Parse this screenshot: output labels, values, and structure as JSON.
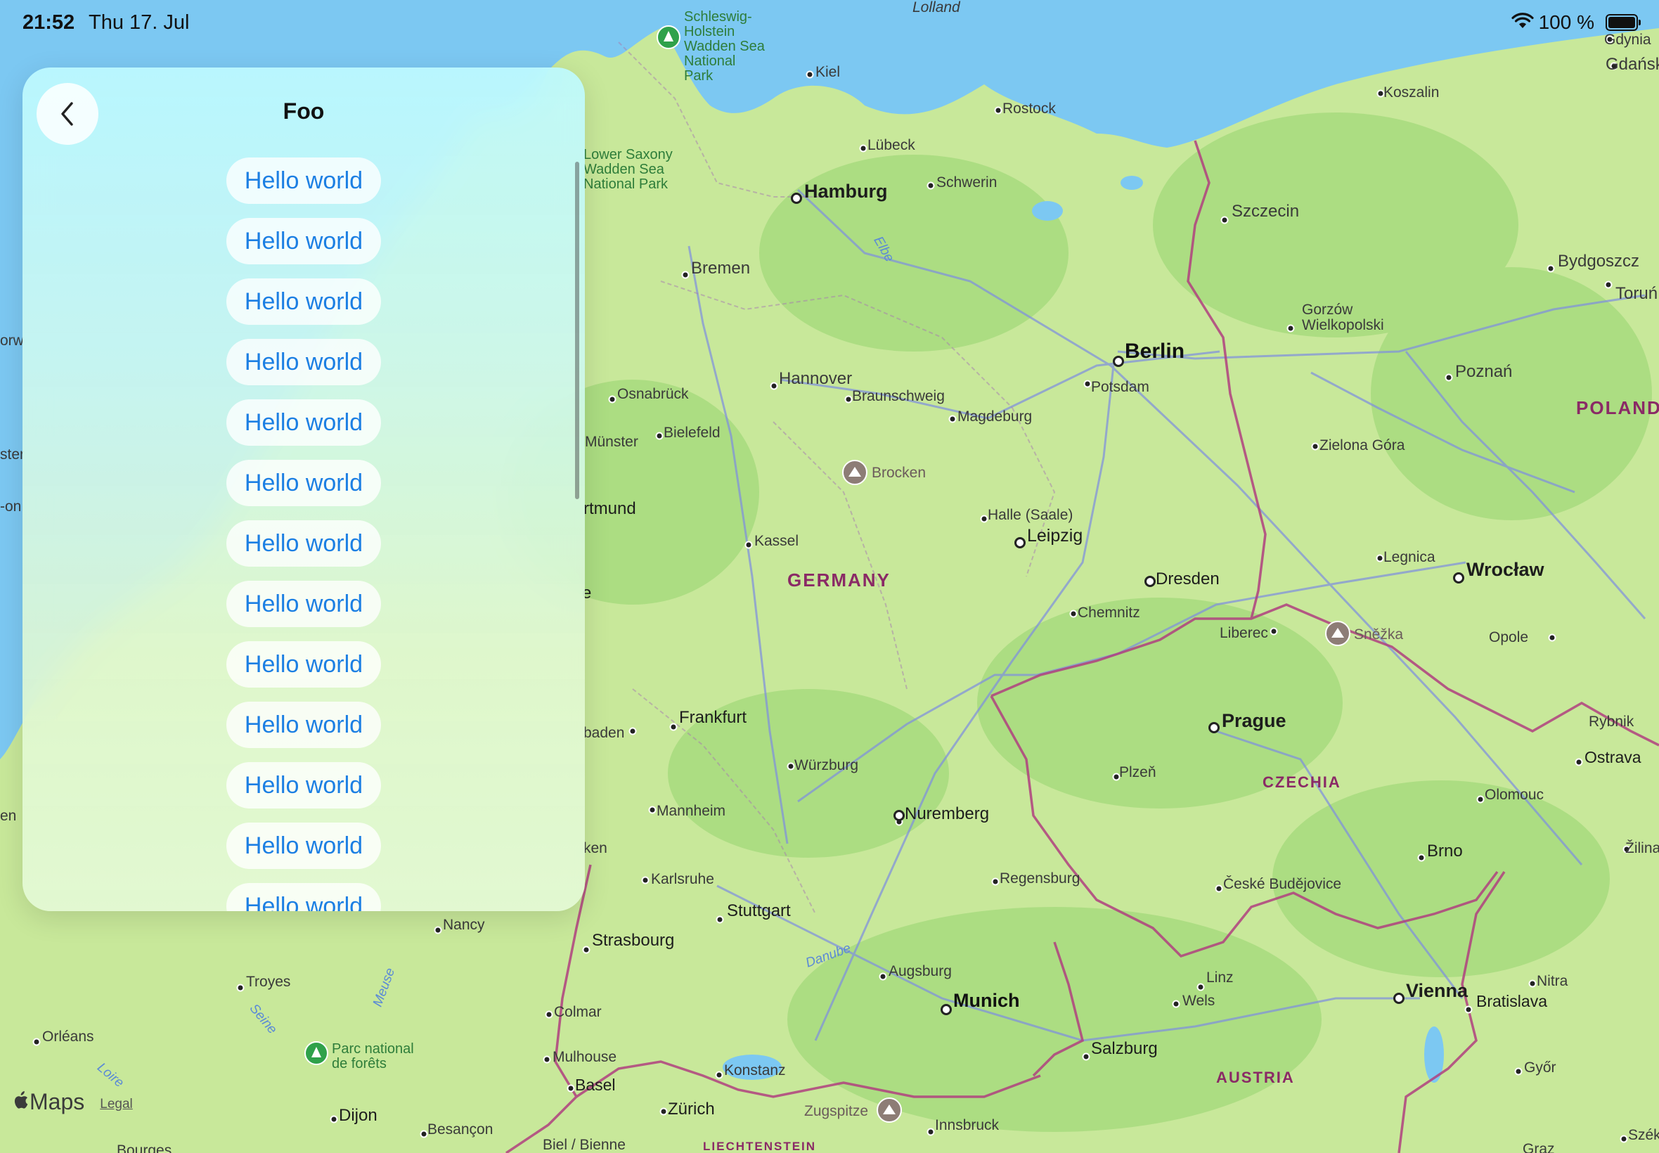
{
  "status_bar": {
    "time": "21:52",
    "date": "Thu 17. Jul",
    "battery_percent": "100 %",
    "wifi_icon": "wifi-icon",
    "battery_icon": "battery-icon"
  },
  "panel": {
    "title": "Foo",
    "back_icon": "chevron-left-icon",
    "items": [
      "Hello world",
      "Hello world",
      "Hello world",
      "Hello world",
      "Hello world",
      "Hello world",
      "Hello world",
      "Hello world",
      "Hello world",
      "Hello world",
      "Hello world",
      "Hello world",
      "Hello world"
    ]
  },
  "map": {
    "labels": {
      "lolland": "Lolland",
      "schleswig": "Schleswig-Holstein Wadden Sea National Park",
      "kiel": "Kiel",
      "rostock": "Rostock",
      "lubeck": "Lübeck",
      "schwerin": "Schwerin",
      "hamburg": "Hamburg",
      "lower_saxony": "Lower Saxony Wadden Sea National Park",
      "bremen": "Bremen",
      "elbe": "Elbe",
      "szczecin": "Szczecin",
      "koszalin": "Koszalin",
      "gdynia": "Gdynia",
      "gdansk": "Gdańsk",
      "bydgoszcz": "Bydgoszcz",
      "torun": "Toruń",
      "gorzow": "Gorzów Wielkopolski",
      "berlin": "Berlin",
      "potsdam": "Potsdam",
      "poznan": "Poznań",
      "poland": "POLAND",
      "hannover": "Hannover",
      "braunschweig": "Braunschweig",
      "magdeburg": "Magdeburg",
      "osnabruck": "Osnabrück",
      "bielefeld": "Bielefeld",
      "munster": "Münster",
      "zielona": "Zielona Góra",
      "brocken": "Brocken",
      "dortmund": "rtmund",
      "halle": "Halle (Saale)",
      "leipzig": "Leipzig",
      "kassel": "Kassel",
      "legnica": "Legnica",
      "wroclaw": "Wrocław",
      "germany": "GERMANY",
      "dresden": "Dresden",
      "chemnitz": "Chemnitz",
      "liberec": "Liberec",
      "snezka": "Sněžka",
      "opole": "Opole",
      "frankfurt": "Frankfurt",
      "wiesbaden": "baden",
      "prague": "Prague",
      "rybnik": "Rybnik",
      "ostrava": "Ostrava",
      "wurzburg": "Würzburg",
      "plzen": "Plzeň",
      "czechia": "CZECHIA",
      "olomouc": "Olomouc",
      "mannheim": "Mannheim",
      "nuremberg": "Nuremberg",
      "brno": "Brno",
      "zilina": "Žilina",
      "karlsruhe": "Karlsruhe",
      "regensburg": "Regensburg",
      "ceske": "České Budějovice",
      "stuttgart": "Stuttgart",
      "nancy": "Nancy",
      "strasbourg": "Strasbourg",
      "danube": "Danube",
      "troyes": "Troyes",
      "augsburg": "Augsburg",
      "linz": "Linz",
      "wels": "Wels",
      "vienna": "Vienna",
      "bratislava": "Bratislava",
      "nitra": "Nitra",
      "munich": "Munich",
      "colmar": "Colmar",
      "meuse": "Meuse",
      "seine": "Seine",
      "orleans": "Orléans",
      "parc": "Parc national de forêts",
      "salzburg": "Salzburg",
      "mulhouse": "Mulhouse",
      "konstanz": "Konstanz",
      "gyor": "Győr",
      "austria": "AUSTRIA",
      "basel": "Basel",
      "zurich": "Zürich",
      "zugspitze": "Zugspitze",
      "innsbruck": "Innsbruck",
      "dijon": "Dijon",
      "besancon": "Besançon",
      "biel": "Biel / Bienne",
      "liechtenstein": "LIECHTENSTEIN",
      "graz": "Graz",
      "szekes": "Széke",
      "bourges": "Bourges",
      "loire": "Loire",
      "left_edge_1": "orw",
      "left_edge_2": "ster",
      "left_edge_3": "-on",
      "left_edge_4": "en",
      "left_edge_5": "e",
      "left_edge_6": "ken"
    },
    "colors": {
      "water": "#7cc8f2",
      "land": "#c8e89a",
      "forest": "#a9dc80",
      "border": "#b0407f",
      "road": "#7e8ee0"
    }
  },
  "branding": {
    "logo_icon": "apple-logo-icon",
    "name": "Maps",
    "legal": "Legal"
  }
}
